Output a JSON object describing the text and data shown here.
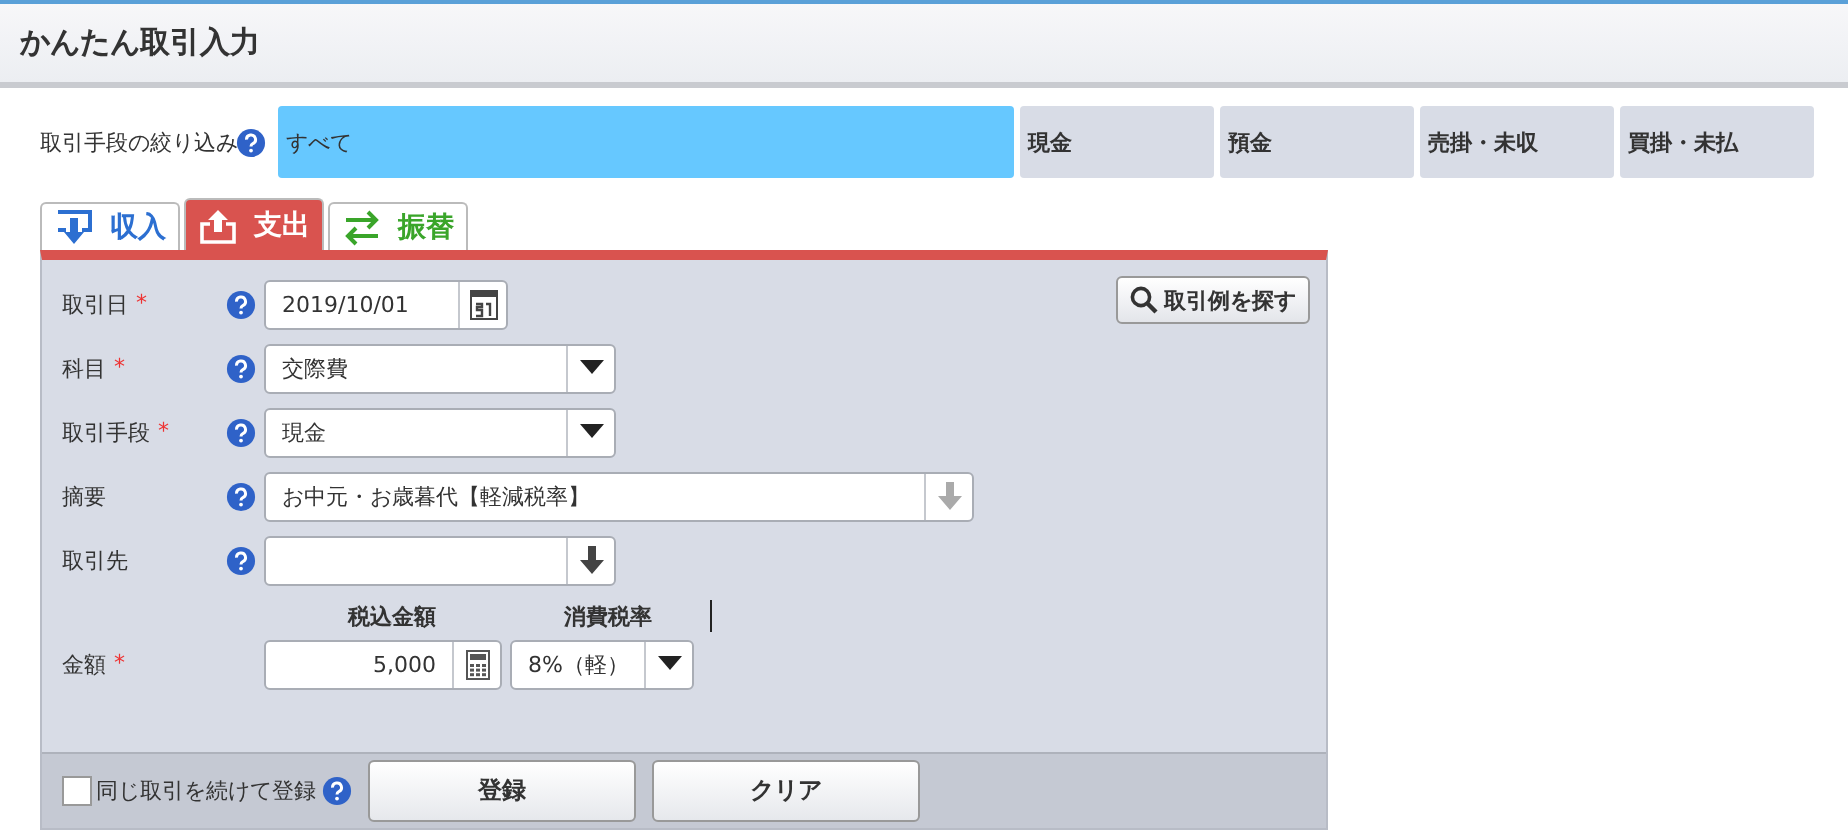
{
  "window": {
    "title": "かんたん取引入力"
  },
  "filter": {
    "label": "取引手段の絞り込み",
    "options": [
      {
        "label": "すべて",
        "selected": true
      },
      {
        "label": "現金",
        "selected": false
      },
      {
        "label": "預金",
        "selected": false
      },
      {
        "label": "売掛・未収",
        "selected": false
      },
      {
        "label": "買掛・未払",
        "selected": false
      }
    ]
  },
  "tabs": [
    {
      "label": "収入",
      "kind": "income",
      "selected": false
    },
    {
      "label": "支出",
      "kind": "expense",
      "selected": true
    },
    {
      "label": "振替",
      "kind": "transfer",
      "selected": false
    }
  ],
  "search_button": "取引例を探す",
  "fields": [
    {
      "kind": "date",
      "label": "取引日",
      "mark": "*",
      "value": "2019/10/01"
    },
    {
      "kind": "select",
      "label": "科目",
      "mark": "*",
      "value": "交際費"
    },
    {
      "kind": "select",
      "label": "取引手段",
      "mark": "*",
      "value": "現金"
    },
    {
      "kind": "wide",
      "label": "摘要",
      "value": "お中元・お歳暮代【軽減税率】"
    },
    {
      "kind": "partner",
      "label": "取引先"
    }
  ],
  "amount": {
    "label": "金額",
    "mark": "*",
    "amount_heading": "税込金額",
    "tax_heading": "消費税率",
    "value": "5,000",
    "tax": "8%（軽）"
  },
  "footer": {
    "repeat_label": "同じ取引を続けて登録",
    "repeat_checked": false,
    "buttons": [
      "登録",
      "クリア"
    ]
  }
}
